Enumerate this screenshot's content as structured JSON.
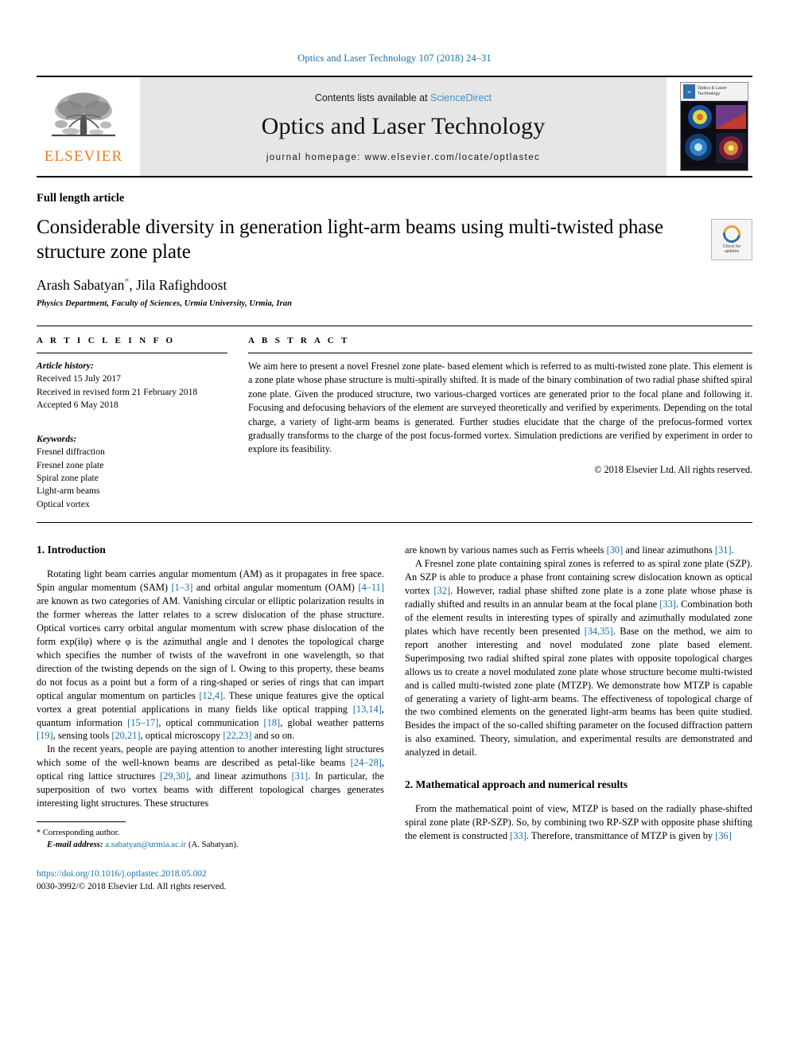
{
  "running_head": "Optics and Laser Technology 107 (2018) 24–31",
  "masthead": {
    "publisher_name": "ELSEVIER",
    "contents_prefix": "Contents lists available at ",
    "contents_link": "ScienceDirect",
    "journal_title": "Optics and Laser Technology",
    "homepage": "journal homepage: www.elsevier.com/locate/optlastec",
    "cover_title_line1": "Optics & Laser",
    "cover_title_line2": "Technology"
  },
  "article": {
    "type": "Full length article",
    "title": "Considerable diversity in generation light-arm beams using multi-twisted phase structure zone plate",
    "authors_part1": "Arash Sabatyan",
    "authors_star": "*",
    "authors_part2": ", Jila Rafighdoost",
    "affiliation": "Physics Department, Faculty of Sciences, Urmia University, Urmia, Iran",
    "crossmark_line1": "Check for",
    "crossmark_line2": "updates"
  },
  "article_info": {
    "label": "A R T I C L E   I N F O",
    "history_head": "Article history:",
    "history": [
      "Received 15 July 2017",
      "Received in revised form 21 February 2018",
      "Accepted 6 May 2018"
    ],
    "keywords_head": "Keywords:",
    "keywords": [
      "Fresnel diffraction",
      "Fresnel zone plate",
      "Spiral zone plate",
      "Light-arm beams",
      "Optical vortex"
    ]
  },
  "abstract": {
    "label": "A B S T R A C T",
    "text": "We aim here to present a novel Fresnel zone plate- based element which is referred to as multi-twisted zone plate. This element is a zone plate whose phase structure is multi-spirally shifted. It is made of the binary combination of two radial phase shifted spiral zone plate. Given the produced structure, two various-charged vortices are generated prior to the focal plane and following it. Focusing and defocusing behaviors of the element are surveyed theoretically and verified by experiments. Depending on the total charge, a variety of light-arm beams is generated. Further studies elucidate that the charge of the prefocus-formed vortex gradually transforms to the charge of the post focus-formed vortex. Simulation predictions are verified by experiment in order to explore its feasibility.",
    "copyright": "© 2018 Elsevier Ltd. All rights reserved."
  },
  "sections": {
    "introduction_heading": "1. Introduction",
    "math_heading": "2. Mathematical approach and numerical results"
  },
  "body": {
    "left": {
      "p1_a": "Rotating light beam carries angular momentum (AM) as it propagates in free space. Spin angular momentum (SAM) ",
      "p1_ref1": "[1–3]",
      "p1_b": " and orbital angular momentum (OAM) ",
      "p1_ref2": "[4–11]",
      "p1_c": " are known as two categories of AM. Vanishing circular or elliptic polarization results in the former whereas the latter relates to a screw dislocation of the phase structure. Optical vortices carry orbital angular momentum with screw phase dislocation of the form exp(ilφ) where φ is the azimuthal angle and l denotes the topological charge which specifies the number of twists of the wavefront in one wavelength, so that direction of the twisting depends on the sign of l. Owing to this property, these beams do not focus as a point but a form of a ring-shaped or series of rings that can impart optical angular momentum on particles ",
      "p1_ref3": "[12,4]",
      "p1_d": ". These unique features give the optical vortex a great potential applications in many fields like optical trapping ",
      "p1_ref4": "[13,14]",
      "p1_e": ", quantum information ",
      "p1_ref5": "[15–17]",
      "p1_f": ", optical communication ",
      "p1_ref6": "[18]",
      "p1_g": ", global weather patterns ",
      "p1_ref7": "[19]",
      "p1_h": ", sensing tools ",
      "p1_ref8": "[20,21]",
      "p1_i": ", optical microscopy ",
      "p1_ref9": "[22,23]",
      "p1_j": " and so on.",
      "p2_a": "In the recent years, people are paying attention to another interesting light structures which some of the well-known beams are described as petal-like beams ",
      "p2_ref1": "[24–28]",
      "p2_b": ", optical ring lattice structures ",
      "p2_ref2": "[29,30]",
      "p2_c": ", and linear azimuthons ",
      "p2_ref3": "[31]",
      "p2_d": ". In particular, the superposition of two vortex beams with different topological charges generates interesting light structures. These structures"
    },
    "right": {
      "p1_a": "are known by various names such as Ferris wheels ",
      "p1_ref1": "[30]",
      "p1_b": " and linear azimuthons ",
      "p1_ref2": "[31]",
      "p1_c": ".",
      "p2_a": "A Fresnel zone plate containing spiral zones is referred to as spiral zone plate (SZP). An SZP is able to produce a phase front containing screw dislocation known as optical vortex ",
      "p2_ref1": "[32]",
      "p2_b": ". However, radial phase shifted zone plate is a zone plate whose phase is radially shifted and results in an annular beam at the focal plane ",
      "p2_ref2": "[33]",
      "p2_c": ". Combination both of the element results in interesting types of spirally and azimuthally modulated zone plates which have recently been presented ",
      "p2_ref3": "[34,35]",
      "p2_d": ". Base on the method, we aim to report another interesting and novel modulated zone plate based element. Superimposing two radial shifted spiral zone plates with opposite topological charges allows us to create a novel modulated zone plate whose structure become multi-twisted and is called multi-twisted zone plate (MTZP). We demonstrate how MTZP is capable of generating a variety of light-arm beams. The effectiveness of topological charge of the two combined elements on the generated light-arm beams has been quite studied. Besides the impact of the so-called shifting parameter on the focused diffraction pattern is also examined. Theory, simulation, and experimental results are demonstrated and analyzed in detail.",
      "p3_a": "From the mathematical point of view, MTZP is based on the radially phase-shifted spiral zone plate (RP-SZP). So, by combining two RP-SZP with opposite phase shifting the element is constructed ",
      "p3_ref1": "[33]",
      "p3_b": ". Therefore, transmittance of MTZP is given by ",
      "p3_ref2": "[36]"
    }
  },
  "footnotes": {
    "corresponding_star": "*",
    "corresponding": "Corresponding author.",
    "email_label": "E-mail address:",
    "email": "a.sabatyan@urmia.ac.ir",
    "email_owner": "(A. Sabatyan).",
    "doi": "https://doi.org/10.1016/j.optlastec.2018.05.002",
    "issn_line": "0030-3992/© 2018 Elsevier Ltd. All rights reserved."
  },
  "colors": {
    "link": "#1a6ea8",
    "sciencedirect": "#3a93d0",
    "elsevier_orange": "#ef7c22",
    "band_gray": "#e6e6e6"
  }
}
